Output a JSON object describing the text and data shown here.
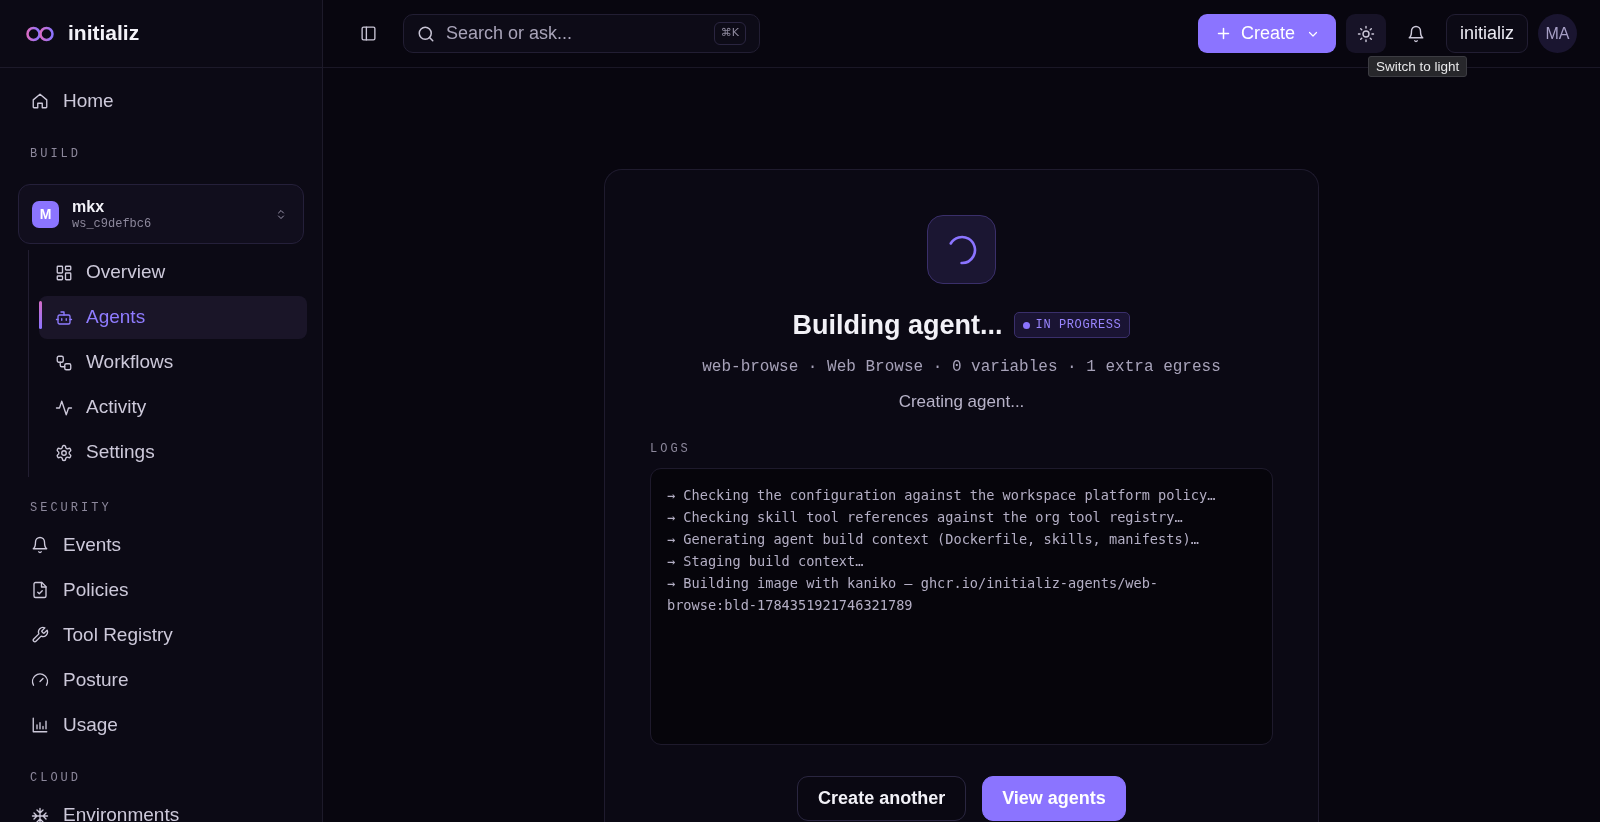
{
  "sidebar": {
    "brand": "initializ",
    "top_items": [
      {
        "label": "Home",
        "selected": false
      }
    ],
    "sections": [
      {
        "title": "BUILD",
        "workspace": {
          "initial": "M",
          "name": "mkx",
          "id": "ws_c9defbc6",
          "children": [
            {
              "label": "Overview",
              "selected": false
            },
            {
              "label": "Agents",
              "selected": true
            },
            {
              "label": "Workflows",
              "selected": false
            },
            {
              "label": "Activity",
              "selected": false
            },
            {
              "label": "Settings",
              "selected": false
            }
          ]
        }
      },
      {
        "title": "SECURITY",
        "items": [
          {
            "label": "Events",
            "selected": false
          },
          {
            "label": "Policies",
            "selected": false
          },
          {
            "label": "Tool Registry",
            "selected": false
          },
          {
            "label": "Posture",
            "selected": false
          },
          {
            "label": "Usage",
            "selected": false
          }
        ]
      },
      {
        "title": "CLOUD",
        "items": [
          {
            "label": "Environments",
            "selected": false
          }
        ]
      }
    ]
  },
  "topbar": {
    "search": {
      "placeholder": "Search or ask...",
      "shortcut": "⌘K"
    },
    "create_button": "Create",
    "theme_toggle": {
      "tooltip": "Switch to light"
    },
    "org_button": "initializ",
    "avatar": "MA"
  },
  "build": {
    "title": "Building agent...",
    "status": "IN PROGRESS",
    "meta": "web-browse · Web Browse · 0 variables · 1 extra egress",
    "message": "Creating agent...",
    "logs_title": "LOGS",
    "logs": [
      "→ Checking the configuration against the workspace platform policy…",
      "→ Checking skill tool references against the org tool registry…",
      "→ Generating agent build context (Dockerfile, skills, manifests)…",
      "→ Staging build context…",
      "→ Building image with kaniko — ghcr.io/initializ-agents/web-browse:bld-1784351921746321789"
    ],
    "buttons": [
      {
        "label": "Create another",
        "kind": "secondary"
      },
      {
        "label": "View agents",
        "kind": "primary"
      }
    ]
  }
}
